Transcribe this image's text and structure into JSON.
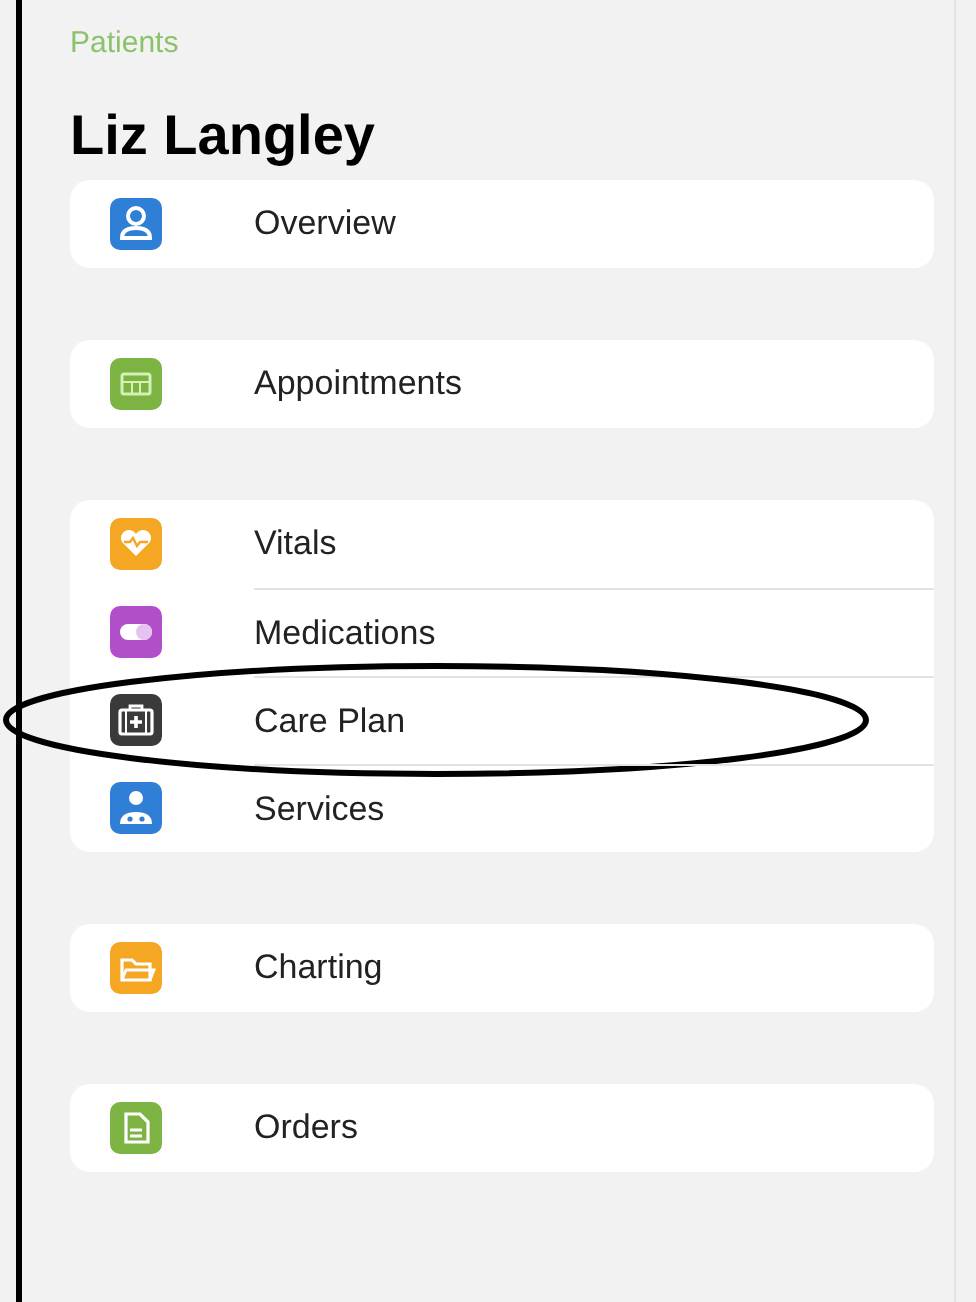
{
  "breadcrumb": "Patients",
  "title": "Liz Langley",
  "groups": [
    {
      "items": [
        {
          "label": "Overview",
          "kind": "person",
          "color": "#2f7fd6",
          "circled": false
        }
      ]
    },
    {
      "items": [
        {
          "label": "Appointments",
          "kind": "calendar",
          "color": "#7cb342",
          "circled": false
        }
      ]
    },
    {
      "items": [
        {
          "label": "Vitals",
          "kind": "heart",
          "color": "#f5a623",
          "circled": false
        },
        {
          "label": "Medications",
          "kind": "pill",
          "color": "#b04fc7",
          "circled": false
        },
        {
          "label": "Care Plan",
          "kind": "kit",
          "color": "#3a3a3a",
          "circled": true
        },
        {
          "label": "Services",
          "kind": "staff",
          "color": "#2f7fd6",
          "circled": false
        }
      ]
    },
    {
      "items": [
        {
          "label": "Charting",
          "kind": "folder",
          "color": "#f5a623",
          "circled": false
        }
      ]
    },
    {
      "items": [
        {
          "label": "Orders",
          "kind": "document",
          "color": "#7cb342",
          "circled": false
        }
      ]
    }
  ]
}
